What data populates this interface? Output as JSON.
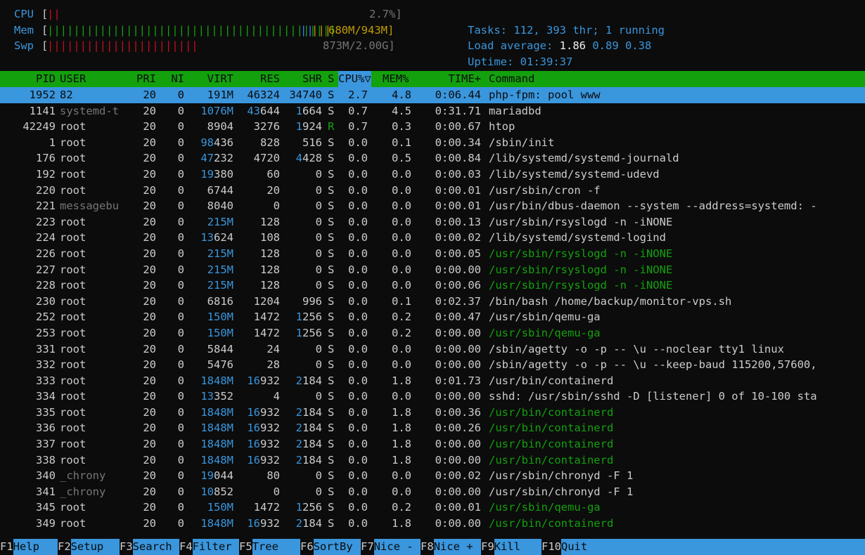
{
  "meters": {
    "cpu": {
      "label": "CPU",
      "value_text": "2.7%]",
      "fraction": 0.027
    },
    "mem": {
      "label": "Mem",
      "value_text": "680M/943M]",
      "fraction": 0.72
    },
    "swp": {
      "label": "Swp",
      "value_text": "873M/2.00G]",
      "fraction": 0.43
    }
  },
  "summary": {
    "tasks_label": "Tasks: ",
    "tasks": "112",
    "sep1": ", ",
    "threads": "393",
    "thr_label": " thr; ",
    "running": "1",
    "running_label": " running",
    "load_label": "Load average: ",
    "load1": "1.86",
    "load5": "0.89",
    "load15": "0.38",
    "uptime_label": "Uptime: ",
    "uptime": "01:39:37"
  },
  "columns": {
    "pid": "PID",
    "user": "USER",
    "pri": "PRI",
    "ni": "NI",
    "virt": "VIRT",
    "res": "RES",
    "shr": "SHR",
    "s": "S",
    "cpu": "CPU%▽",
    "mem": "MEM%",
    "time": "TIME+",
    "command": "Command"
  },
  "processes": [
    {
      "pid": "1952",
      "user": "82",
      "pri": "20",
      "ni": "0",
      "virt": "191M",
      "res": "46324",
      "shr": "34740",
      "s": "S",
      "cpu": "2.7",
      "mem": "4.8",
      "time": "0:06.44",
      "command": "php-fpm: pool www",
      "selected": true
    },
    {
      "pid": "1141",
      "user": "systemd-t",
      "pri": "20",
      "ni": "0",
      "virt": "1076M",
      "res": "43644",
      "shr": "1664",
      "s": "S",
      "cpu": "0.7",
      "mem": "4.5",
      "time": "0:31.71",
      "command": "mariadbd"
    },
    {
      "pid": "42249",
      "user": "root",
      "pri": "20",
      "ni": "0",
      "virt": "8904",
      "res": "3276",
      "shr": "1924",
      "s": "R",
      "cpu": "0.7",
      "mem": "0.3",
      "time": "0:00.67",
      "command": "htop"
    },
    {
      "pid": "1",
      "user": "root",
      "pri": "20",
      "ni": "0",
      "virt": "98436",
      "res": "828",
      "shr": "516",
      "s": "S",
      "cpu": "0.0",
      "mem": "0.1",
      "time": "0:00.34",
      "command": "/sbin/init"
    },
    {
      "pid": "176",
      "user": "root",
      "pri": "20",
      "ni": "0",
      "virt": "47232",
      "res": "4720",
      "shr": "4428",
      "s": "S",
      "cpu": "0.0",
      "mem": "0.5",
      "time": "0:00.84",
      "command": "/lib/systemd/systemd-journald"
    },
    {
      "pid": "192",
      "user": "root",
      "pri": "20",
      "ni": "0",
      "virt": "19380",
      "res": "60",
      "shr": "0",
      "s": "S",
      "cpu": "0.0",
      "mem": "0.0",
      "time": "0:00.03",
      "command": "/lib/systemd/systemd-udevd"
    },
    {
      "pid": "220",
      "user": "root",
      "pri": "20",
      "ni": "0",
      "virt": "6744",
      "res": "20",
      "shr": "0",
      "s": "S",
      "cpu": "0.0",
      "mem": "0.0",
      "time": "0:00.01",
      "command": "/usr/sbin/cron -f"
    },
    {
      "pid": "221",
      "user": "messagebu",
      "pri": "20",
      "ni": "0",
      "virt": "8040",
      "res": "0",
      "shr": "0",
      "s": "S",
      "cpu": "0.0",
      "mem": "0.0",
      "time": "0:00.01",
      "command": "/usr/bin/dbus-daemon --system --address=systemd: -"
    },
    {
      "pid": "223",
      "user": "root",
      "pri": "20",
      "ni": "0",
      "virt": "215M",
      "res": "128",
      "shr": "0",
      "s": "S",
      "cpu": "0.0",
      "mem": "0.0",
      "time": "0:00.13",
      "command": "/usr/sbin/rsyslogd -n -iNONE"
    },
    {
      "pid": "224",
      "user": "root",
      "pri": "20",
      "ni": "0",
      "virt": "13624",
      "res": "108",
      "shr": "0",
      "s": "S",
      "cpu": "0.0",
      "mem": "0.0",
      "time": "0:00.02",
      "command": "/lib/systemd/systemd-logind"
    },
    {
      "pid": "226",
      "user": "root",
      "pri": "20",
      "ni": "0",
      "virt": "215M",
      "res": "128",
      "shr": "0",
      "s": "S",
      "cpu": "0.0",
      "mem": "0.0",
      "time": "0:00.05",
      "command": "/usr/sbin/rsyslogd -n -iNONE",
      "thread": true
    },
    {
      "pid": "227",
      "user": "root",
      "pri": "20",
      "ni": "0",
      "virt": "215M",
      "res": "128",
      "shr": "0",
      "s": "S",
      "cpu": "0.0",
      "mem": "0.0",
      "time": "0:00.00",
      "command": "/usr/sbin/rsyslogd -n -iNONE",
      "thread": true
    },
    {
      "pid": "228",
      "user": "root",
      "pri": "20",
      "ni": "0",
      "virt": "215M",
      "res": "128",
      "shr": "0",
      "s": "S",
      "cpu": "0.0",
      "mem": "0.0",
      "time": "0:00.06",
      "command": "/usr/sbin/rsyslogd -n -iNONE",
      "thread": true
    },
    {
      "pid": "230",
      "user": "root",
      "pri": "20",
      "ni": "0",
      "virt": "6816",
      "res": "1204",
      "shr": "996",
      "s": "S",
      "cpu": "0.0",
      "mem": "0.1",
      "time": "0:02.37",
      "command": "/bin/bash /home/backup/monitor-vps.sh"
    },
    {
      "pid": "252",
      "user": "root",
      "pri": "20",
      "ni": "0",
      "virt": "150M",
      "res": "1472",
      "shr": "1256",
      "s": "S",
      "cpu": "0.0",
      "mem": "0.2",
      "time": "0:00.47",
      "command": "/usr/sbin/qemu-ga"
    },
    {
      "pid": "253",
      "user": "root",
      "pri": "20",
      "ni": "0",
      "virt": "150M",
      "res": "1472",
      "shr": "1256",
      "s": "S",
      "cpu": "0.0",
      "mem": "0.2",
      "time": "0:00.00",
      "command": "/usr/sbin/qemu-ga",
      "thread": true
    },
    {
      "pid": "331",
      "user": "root",
      "pri": "20",
      "ni": "0",
      "virt": "5844",
      "res": "24",
      "shr": "0",
      "s": "S",
      "cpu": "0.0",
      "mem": "0.0",
      "time": "0:00.00",
      "command": "/sbin/agetty -o -p -- \\u --noclear tty1 linux"
    },
    {
      "pid": "332",
      "user": "root",
      "pri": "20",
      "ni": "0",
      "virt": "5476",
      "res": "28",
      "shr": "0",
      "s": "S",
      "cpu": "0.0",
      "mem": "0.0",
      "time": "0:00.00",
      "command": "/sbin/agetty -o -p -- \\u --keep-baud 115200,57600,"
    },
    {
      "pid": "333",
      "user": "root",
      "pri": "20",
      "ni": "0",
      "virt": "1848M",
      "res": "16932",
      "shr": "2184",
      "s": "S",
      "cpu": "0.0",
      "mem": "1.8",
      "time": "0:01.73",
      "command": "/usr/bin/containerd"
    },
    {
      "pid": "334",
      "user": "root",
      "pri": "20",
      "ni": "0",
      "virt": "13352",
      "res": "4",
      "shr": "0",
      "s": "S",
      "cpu": "0.0",
      "mem": "0.0",
      "time": "0:00.00",
      "command": "sshd: /usr/sbin/sshd -D [listener] 0 of 10-100 sta"
    },
    {
      "pid": "335",
      "user": "root",
      "pri": "20",
      "ni": "0",
      "virt": "1848M",
      "res": "16932",
      "shr": "2184",
      "s": "S",
      "cpu": "0.0",
      "mem": "1.8",
      "time": "0:00.36",
      "command": "/usr/bin/containerd",
      "thread": true
    },
    {
      "pid": "336",
      "user": "root",
      "pri": "20",
      "ni": "0",
      "virt": "1848M",
      "res": "16932",
      "shr": "2184",
      "s": "S",
      "cpu": "0.0",
      "mem": "1.8",
      "time": "0:00.26",
      "command": "/usr/bin/containerd",
      "thread": true
    },
    {
      "pid": "337",
      "user": "root",
      "pri": "20",
      "ni": "0",
      "virt": "1848M",
      "res": "16932",
      "shr": "2184",
      "s": "S",
      "cpu": "0.0",
      "mem": "1.8",
      "time": "0:00.00",
      "command": "/usr/bin/containerd",
      "thread": true
    },
    {
      "pid": "338",
      "user": "root",
      "pri": "20",
      "ni": "0",
      "virt": "1848M",
      "res": "16932",
      "shr": "2184",
      "s": "S",
      "cpu": "0.0",
      "mem": "1.8",
      "time": "0:00.00",
      "command": "/usr/bin/containerd",
      "thread": true
    },
    {
      "pid": "340",
      "user": "_chrony",
      "pri": "20",
      "ni": "0",
      "virt": "19044",
      "res": "80",
      "shr": "0",
      "s": "S",
      "cpu": "0.0",
      "mem": "0.0",
      "time": "0:00.02",
      "command": "/usr/sbin/chronyd -F 1"
    },
    {
      "pid": "341",
      "user": "_chrony",
      "pri": "20",
      "ni": "0",
      "virt": "10852",
      "res": "0",
      "shr": "0",
      "s": "S",
      "cpu": "0.0",
      "mem": "0.0",
      "time": "0:00.00",
      "command": "/usr/sbin/chronyd -F 1"
    },
    {
      "pid": "345",
      "user": "root",
      "pri": "20",
      "ni": "0",
      "virt": "150M",
      "res": "1472",
      "shr": "1256",
      "s": "S",
      "cpu": "0.0",
      "mem": "0.2",
      "time": "0:00.01",
      "command": "/usr/sbin/qemu-ga",
      "thread": true
    },
    {
      "pid": "349",
      "user": "root",
      "pri": "20",
      "ni": "0",
      "virt": "1848M",
      "res": "16932",
      "shr": "2184",
      "s": "S",
      "cpu": "0.0",
      "mem": "1.8",
      "time": "0:00.00",
      "command": "/usr/bin/containerd",
      "thread": true
    }
  ],
  "function_keys": [
    {
      "key": "F1",
      "label": "Help"
    },
    {
      "key": "F2",
      "label": "Setup"
    },
    {
      "key": "F3",
      "label": "Search"
    },
    {
      "key": "F4",
      "label": "Filter"
    },
    {
      "key": "F5",
      "label": "Tree"
    },
    {
      "key": "F6",
      "label": "SortBy"
    },
    {
      "key": "F7",
      "label": "Nice -"
    },
    {
      "key": "F8",
      "label": "Nice +"
    },
    {
      "key": "F9",
      "label": "Kill"
    },
    {
      "key": "F10",
      "label": "Quit"
    }
  ],
  "colors": {
    "background": "#0c0c0c",
    "header_bar": "#13a10e",
    "selection": "#3a96dd",
    "text": "#cccccc",
    "thread_text": "#13a10e",
    "large_number": "#3a96dd"
  }
}
